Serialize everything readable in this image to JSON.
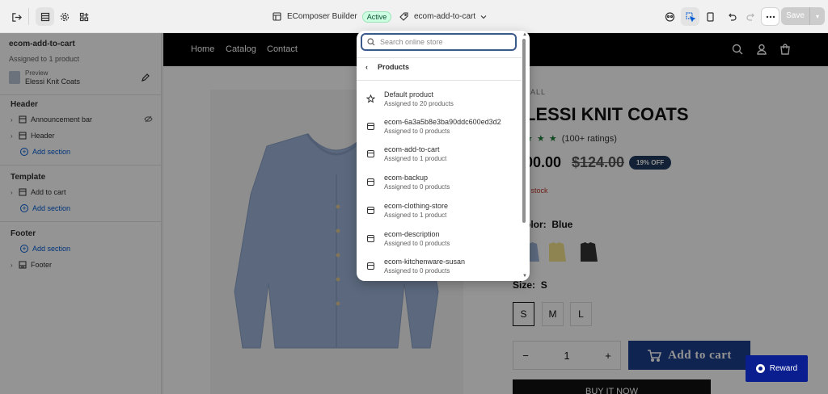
{
  "topbar": {
    "app_title": "EComposer Builder",
    "status_badge": "Active",
    "template_name": "ecom-add-to-cart",
    "save_label": "Save"
  },
  "sidebar": {
    "title": "ecom-add-to-cart",
    "subtitle": "Assigned to 1 product",
    "preview_label": "Preview",
    "preview_product": "Elessi Knit Coats",
    "sections": [
      {
        "heading": "Header",
        "items": [
          "Announcement bar",
          "Header"
        ],
        "add_label": "Add section"
      },
      {
        "heading": "Template",
        "items": [
          "Add to cart"
        ],
        "add_label": "Add section"
      },
      {
        "heading": "Footer",
        "items": [
          "Footer"
        ],
        "add_label": "Add section"
      }
    ]
  },
  "store": {
    "nav": [
      "Home",
      "Catalog",
      "Contact"
    ],
    "vendor": "SALL",
    "product_title": "LESSI KNIT COATS",
    "stars": "★ ★ ★",
    "rating_text": "(100+ ratings)",
    "price": "00.00",
    "compare_price": "$124.00",
    "discount_badge": "19% OFF",
    "stock_text": "n stock",
    "color_label": "olor:",
    "color_value": "Blue",
    "size_label": "Size:",
    "size_value": "S",
    "sizes": [
      "S",
      "M",
      "L"
    ],
    "quantity": "1",
    "qty_minus": "−",
    "qty_plus": "+",
    "add_to_cart": "Add to cart",
    "buy_now": "BUY IT NOW",
    "reward": "Reward"
  },
  "dropdown": {
    "search_placeholder": "Search online store",
    "back_label": "Products",
    "items": [
      {
        "name": "Default product",
        "count": "Assigned to 20 products",
        "icon": "star-icon"
      },
      {
        "name": "ecom-6a3a5b8e3ba90ddc600ed3d2",
        "count": "Assigned to 0 products",
        "icon": "template-icon"
      },
      {
        "name": "ecom-add-to-cart",
        "count": "Assigned to 1 product",
        "icon": "template-icon"
      },
      {
        "name": "ecom-backup",
        "count": "Assigned to 0 products",
        "icon": "template-icon"
      },
      {
        "name": "ecom-clothing-store",
        "count": "Assigned to 1 product",
        "icon": "template-icon"
      },
      {
        "name": "ecom-description",
        "count": "Assigned to 0 products",
        "icon": "template-icon"
      },
      {
        "name": "ecom-kitchenware-susan",
        "count": "Assigned to 0 products",
        "icon": "template-icon"
      }
    ],
    "selected_index": 2
  },
  "colors": {
    "accent": "#005bd3",
    "cart_button": "#1c3f8c",
    "reward_button": "#0a1e8f",
    "active_badge": "#cdfee1"
  }
}
